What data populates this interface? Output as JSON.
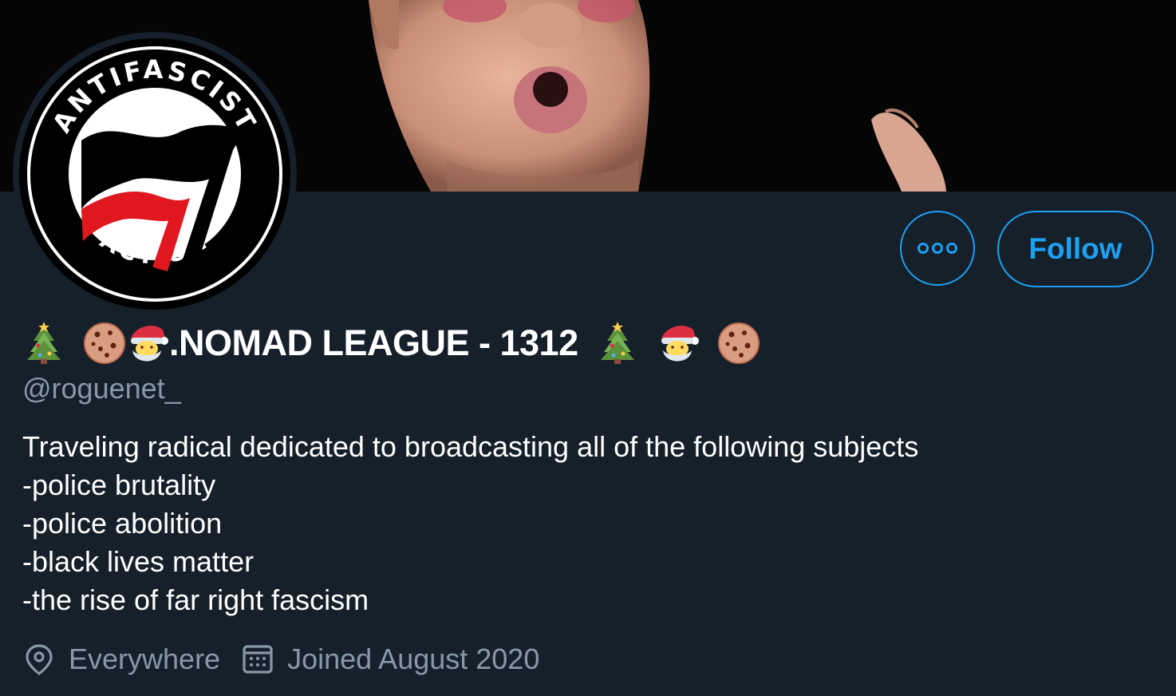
{
  "profile": {
    "display_name": ".NOMAD LEAGUE - 1312",
    "handle": "@roguenet_",
    "avatar_text_top": "ANTIFASCIST",
    "avatar_text_bottom": "ACTION",
    "bio": "Traveling radical dedicated to broadcasting all of the following subjects\n-police brutality\n-police abolition\n-black lives matter\n-the rise of far right fascism",
    "location": "Everywhere",
    "joined": "Joined August 2020"
  },
  "actions": {
    "follow_label": "Follow"
  },
  "icons": {
    "more": "more-options-icon",
    "location": "location-pin-icon",
    "calendar": "calendar-icon",
    "name_emojis": [
      "christmas-tree-icon",
      "cookie-icon",
      "santa-icon",
      "christmas-tree-icon",
      "santa-icon",
      "cookie-icon"
    ]
  },
  "colors": {
    "background": "#15202b",
    "accent": "#1da1f2",
    "secondary_text": "#8899a6",
    "flag_red": "#e0171f"
  }
}
